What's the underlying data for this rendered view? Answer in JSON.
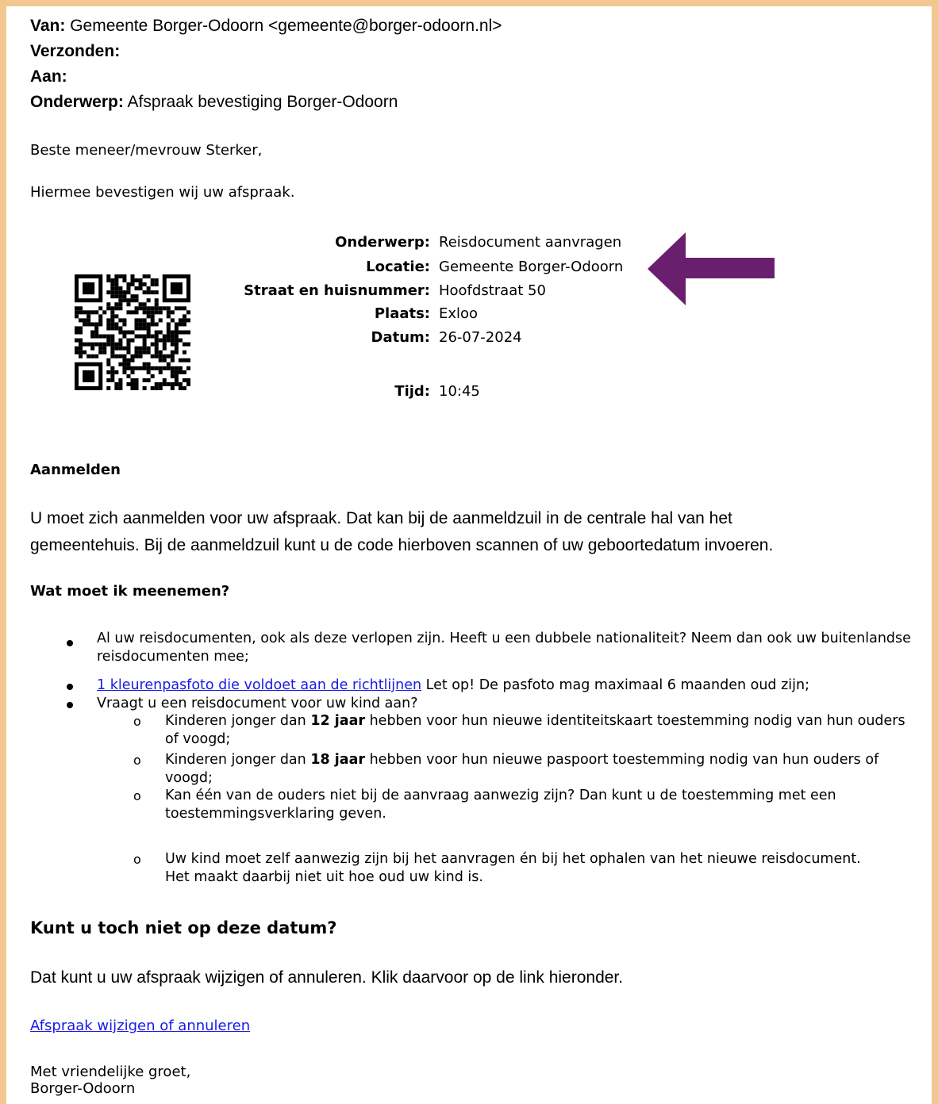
{
  "header": {
    "from_label": "Van:",
    "from_value": "Gemeente Borger-Odoorn <gemeente@borger-odoorn.nl>",
    "sent_label": "Verzonden:",
    "to_label": "Aan:",
    "subject_label": "Onderwerp:",
    "subject_value": "Afspraak bevestiging Borger-Odoorn"
  },
  "greeting": "Beste meneer/mevrouw Sterker,",
  "confirm_text": "Hiermee bevestigen wij uw afspraak.",
  "details": [
    {
      "label": "Onderwerp:",
      "value": "Reisdocument aanvragen"
    },
    {
      "label": "Locatie:",
      "value": "Gemeente Borger-Odoorn"
    },
    {
      "label": "Straat en huisnummer:",
      "value": "Hoofdstraat 50"
    },
    {
      "label": "Plaats:",
      "value": "Exloo"
    },
    {
      "label": "Datum:",
      "value": "26-07-2024"
    },
    {
      "label": "Tijd:",
      "value": "10:45"
    }
  ],
  "arrow_color": "#6a1f6e",
  "register": {
    "heading": "Aanmelden",
    "line1": "U moet zich aanmelden voor uw afspraak. Dat kan bij de aanmeldzuil in de centrale hal van het",
    "line2": "gemeentehuis. Bij de aanmeldzuil kunt u de code hierboven scannen of uw geboortedatum invoeren."
  },
  "bring": {
    "heading": "Wat moet ik meenemen?",
    "item1": "Al uw reisdocumenten, ook als deze verlopen zijn. Heeft u een dubbele nationaliteit? Neem dan ook uw buitenlandse reisdocumenten mee;",
    "item2_link": "1 kleurenpasfoto die voldoet aan de richtlijnen",
    "item2_rest": " Let op! De pasfoto mag maximaal 6 maanden oud zijn;",
    "item3": "Vraagt u een reisdocument voor uw kind aan?",
    "sub1_a": "Kinderen jonger dan ",
    "sub1_b": "12 jaar",
    "sub1_c": " hebben voor hun nieuwe identiteitskaart toestemming nodig van hun ouders of voogd;",
    "sub2_a": "Kinderen jonger dan ",
    "sub2_b": "18 jaar",
    "sub2_c": " hebben voor hun nieuwe paspoort toestemming nodig van hun ouders of voogd;",
    "sub3": "Kan één van de ouders niet bij de aanvraag aanwezig zijn? Dan kunt u de toestemming met een toestemmingsverklaring geven.",
    "sub4": "Uw kind moet zelf aanwezig zijn bij het aanvragen én bij het ophalen van het nieuwe reisdocument. Het maakt daarbij niet uit hoe oud uw kind is.",
    "sub_marker": "o"
  },
  "reschedule": {
    "heading": "Kunt u toch niet op deze datum?",
    "text": "Dat kunt u uw afspraak wijzigen of annuleren. Klik daarvoor op de link hieronder.",
    "link": "Afspraak wijzigen of annuleren"
  },
  "closing": {
    "line1": "Met vriendelijke groet,",
    "line2": "Borger-Odoorn"
  }
}
